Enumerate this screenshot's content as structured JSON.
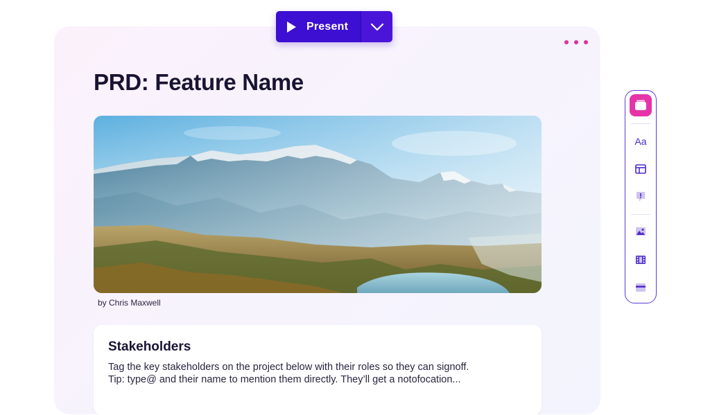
{
  "present": {
    "label": "Present"
  },
  "document": {
    "title": "PRD: Feature Name",
    "image_caption": "by Chris Maxwell"
  },
  "stakeholders": {
    "heading": "Stakeholders",
    "body_line_1": "Tag the key stakeholders on the project below with their roles so they can signoff.",
    "body_line_2": "Tip: type@ and their name to mention them directly. They’ll get a notofocation..."
  },
  "toolbar": {
    "items": [
      {
        "icon": "card-icon",
        "active": true
      },
      {
        "icon": "text-icon"
      },
      {
        "icon": "layout-icon"
      },
      {
        "icon": "callout-icon"
      },
      {
        "icon": "image-icon"
      },
      {
        "icon": "video-icon"
      },
      {
        "icon": "embed-icon"
      }
    ],
    "text_icon_glyph": "Aa"
  },
  "colors": {
    "present_bg": "#3c0fd2",
    "accent_pink": "#e733a8",
    "toolbar_border": "#5a3ad8",
    "icon_purple": "#4a28c8"
  }
}
